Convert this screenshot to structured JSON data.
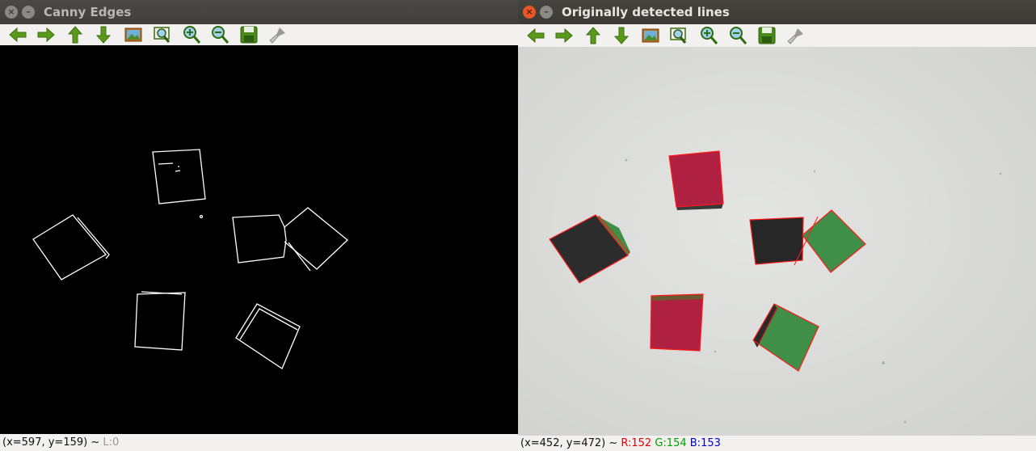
{
  "windows": [
    {
      "title": "Canny Edges",
      "status": {
        "coords": "(x=597, y=159) ~ ",
        "level": "L:0"
      }
    },
    {
      "title": "Originally detected lines",
      "status": {
        "coords": "(x=452, y=472) ~ ",
        "r": "R:152",
        "g": "G:154",
        "b": "B:153"
      }
    }
  ],
  "toolbar_icons": [
    "arrow-left-icon",
    "arrow-right-icon",
    "arrow-up-icon",
    "arrow-down-icon",
    "image-icon",
    "zoom-rect-icon",
    "zoom-in-icon",
    "zoom-out-icon",
    "save-icon",
    "brush-icon"
  ],
  "colors": {
    "icon_green": "#5a9a1a",
    "detected_line": "#ff1a1a",
    "red_block": "#b02040",
    "green_block": "#3f8f48",
    "dark_block": "#2a2a2a"
  }
}
